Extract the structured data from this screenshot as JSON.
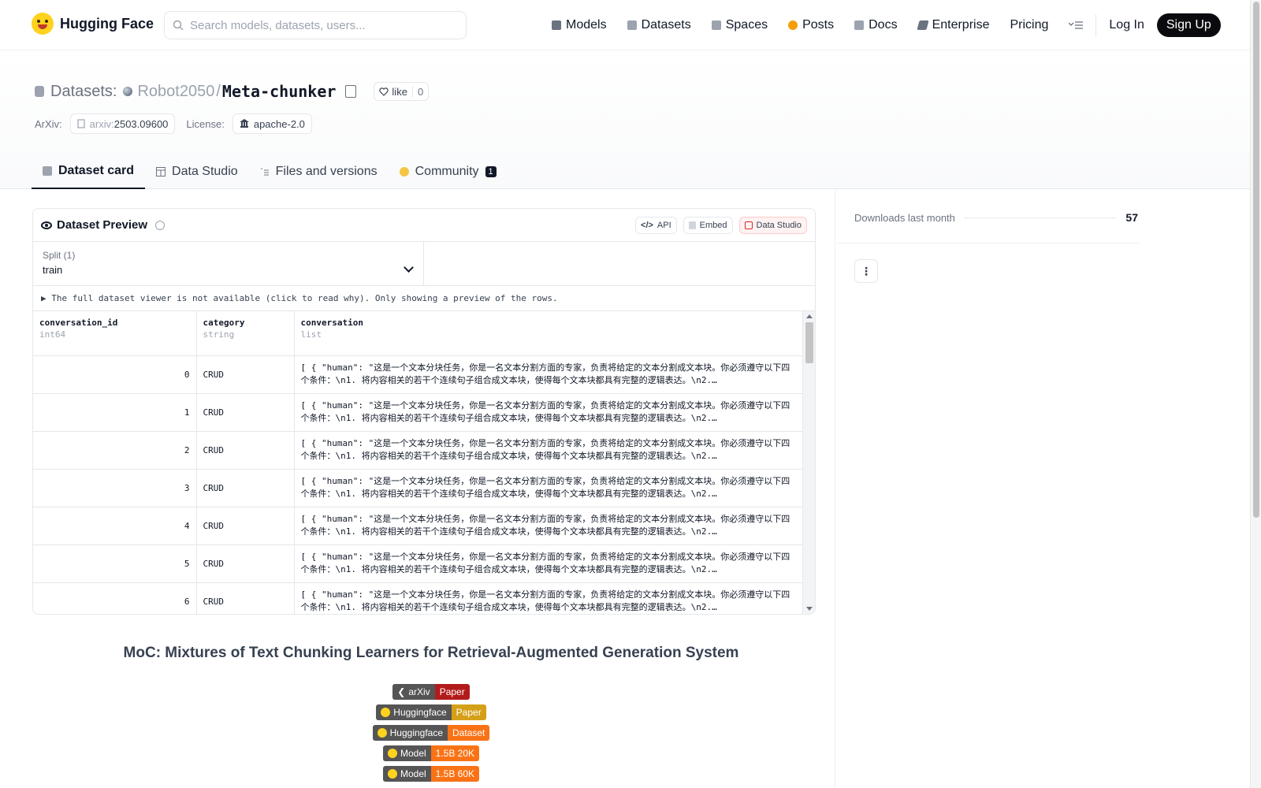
{
  "nav": {
    "brand": "Hugging Face",
    "search_placeholder": "Search models, datasets, users...",
    "items": [
      {
        "label": "Models",
        "icon": "models-icon",
        "color": "#6b7280"
      },
      {
        "label": "Datasets",
        "icon": "datasets-icon",
        "color": "#9ca3af"
      },
      {
        "label": "Spaces",
        "icon": "spaces-icon",
        "color": "#9ca3af"
      },
      {
        "label": "Posts",
        "icon": "posts-icon",
        "color": "#f59e0b"
      },
      {
        "label": "Docs",
        "icon": "docs-icon",
        "color": "#9ca3af"
      },
      {
        "label": "Enterprise",
        "icon": "enterprise-icon",
        "color": "#6b7280"
      },
      {
        "label": "Pricing"
      }
    ],
    "login": "Log In",
    "signup": "Sign Up"
  },
  "header": {
    "section": "Datasets:",
    "user": "Robot2050",
    "separator": "/",
    "repo": "Meta-chunker",
    "like_label": "like",
    "like_count": "0",
    "arxiv_label": "ArXiv:",
    "arxiv_prefix": "arxiv:",
    "arxiv_id": "2503.09600",
    "license_label": "License:",
    "license_value": "apache-2.0"
  },
  "tabs": [
    {
      "label": "Dataset card",
      "active": true
    },
    {
      "label": "Data Studio"
    },
    {
      "label": "Files and versions"
    },
    {
      "label": "Community",
      "badge": "1"
    }
  ],
  "preview": {
    "title": "Dataset Preview",
    "actions": [
      "API",
      "Embed",
      "Data Studio"
    ],
    "split_label": "Split (1)",
    "split_value": "train",
    "notice": "▶ The full dataset viewer is not available (click to read why). Only showing a preview of the rows.",
    "columns": [
      {
        "name": "conversation_id",
        "type": "int64"
      },
      {
        "name": "category",
        "type": "string"
      },
      {
        "name": "conversation",
        "type": "list"
      }
    ],
    "rows": [
      {
        "id": "0",
        "category": "CRUD",
        "conversation": "[ { \"human\": \"这是一个文本分块任务，你是一名文本分割方面的专家，负责将给定的文本分割成文本块。你必须遵守以下四个条件：\\n1. 将内容相关的若干个连续句子组合成文本块，使得每个文本块都具有完整的逻辑表达。\\n2.…"
      },
      {
        "id": "1",
        "category": "CRUD",
        "conversation": "[ { \"human\": \"这是一个文本分块任务，你是一名文本分割方面的专家，负责将给定的文本分割成文本块。你必须遵守以下四个条件：\\n1. 将内容相关的若干个连续句子组合成文本块，使得每个文本块都具有完整的逻辑表达。\\n2.…"
      },
      {
        "id": "2",
        "category": "CRUD",
        "conversation": "[ { \"human\": \"这是一个文本分块任务，你是一名文本分割方面的专家，负责将给定的文本分割成文本块。你必须遵守以下四个条件：\\n1. 将内容相关的若干个连续句子组合成文本块，使得每个文本块都具有完整的逻辑表达。\\n2.…"
      },
      {
        "id": "3",
        "category": "CRUD",
        "conversation": "[ { \"human\": \"这是一个文本分块任务，你是一名文本分割方面的专家，负责将给定的文本分割成文本块。你必须遵守以下四个条件：\\n1. 将内容相关的若干个连续句子组合成文本块，使得每个文本块都具有完整的逻辑表达。\\n2.…"
      },
      {
        "id": "4",
        "category": "CRUD",
        "conversation": "[ { \"human\": \"这是一个文本分块任务，你是一名文本分割方面的专家，负责将给定的文本分割成文本块。你必须遵守以下四个条件：\\n1. 将内容相关的若干个连续句子组合成文本块，使得每个文本块都具有完整的逻辑表达。\\n2.…"
      },
      {
        "id": "5",
        "category": "CRUD",
        "conversation": "[ { \"human\": \"这是一个文本分块任务，你是一名文本分割方面的专家，负责将给定的文本分割成文本块。你必须遵守以下四个条件：\\n1. 将内容相关的若干个连续句子组合成文本块，使得每个文本块都具有完整的逻辑表达。\\n2.…"
      },
      {
        "id": "6",
        "category": "CRUD",
        "conversation": "[ { \"human\": \"这是一个文本分块任务，你是一名文本分割方面的专家，负责将给定的文本分割成文本块。你必须遵守以下四个条件：\\n1. 将内容相关的若干个连续句子组合成文本块，使得每个文本块都具有完整的逻辑表达。\\n2.…"
      }
    ]
  },
  "readme": {
    "title": "MoC: Mixtures of Text Chunking Learners for Retrieval-Augmented Generation System",
    "badges": [
      {
        "left": "arXiv",
        "right": "Paper",
        "color": "#b31b1b",
        "icon": "arxiv-icon"
      },
      {
        "left": "Huggingface",
        "right": "Paper",
        "color": "#d4a017",
        "icon": "huggingface-icon"
      },
      {
        "left": "Huggingface",
        "right": "Dataset",
        "color": "#f97316",
        "icon": "huggingface-icon"
      },
      {
        "left": "Model",
        "right": "1.5B 20K",
        "color": "#f97316",
        "icon": "huggingface-icon"
      },
      {
        "left": "Model",
        "right": "1.5B 60K",
        "color": "#f97316",
        "icon": "huggingface-icon"
      }
    ]
  },
  "sidebar": {
    "downloads_label": "Downloads last month",
    "downloads_value": "57"
  }
}
